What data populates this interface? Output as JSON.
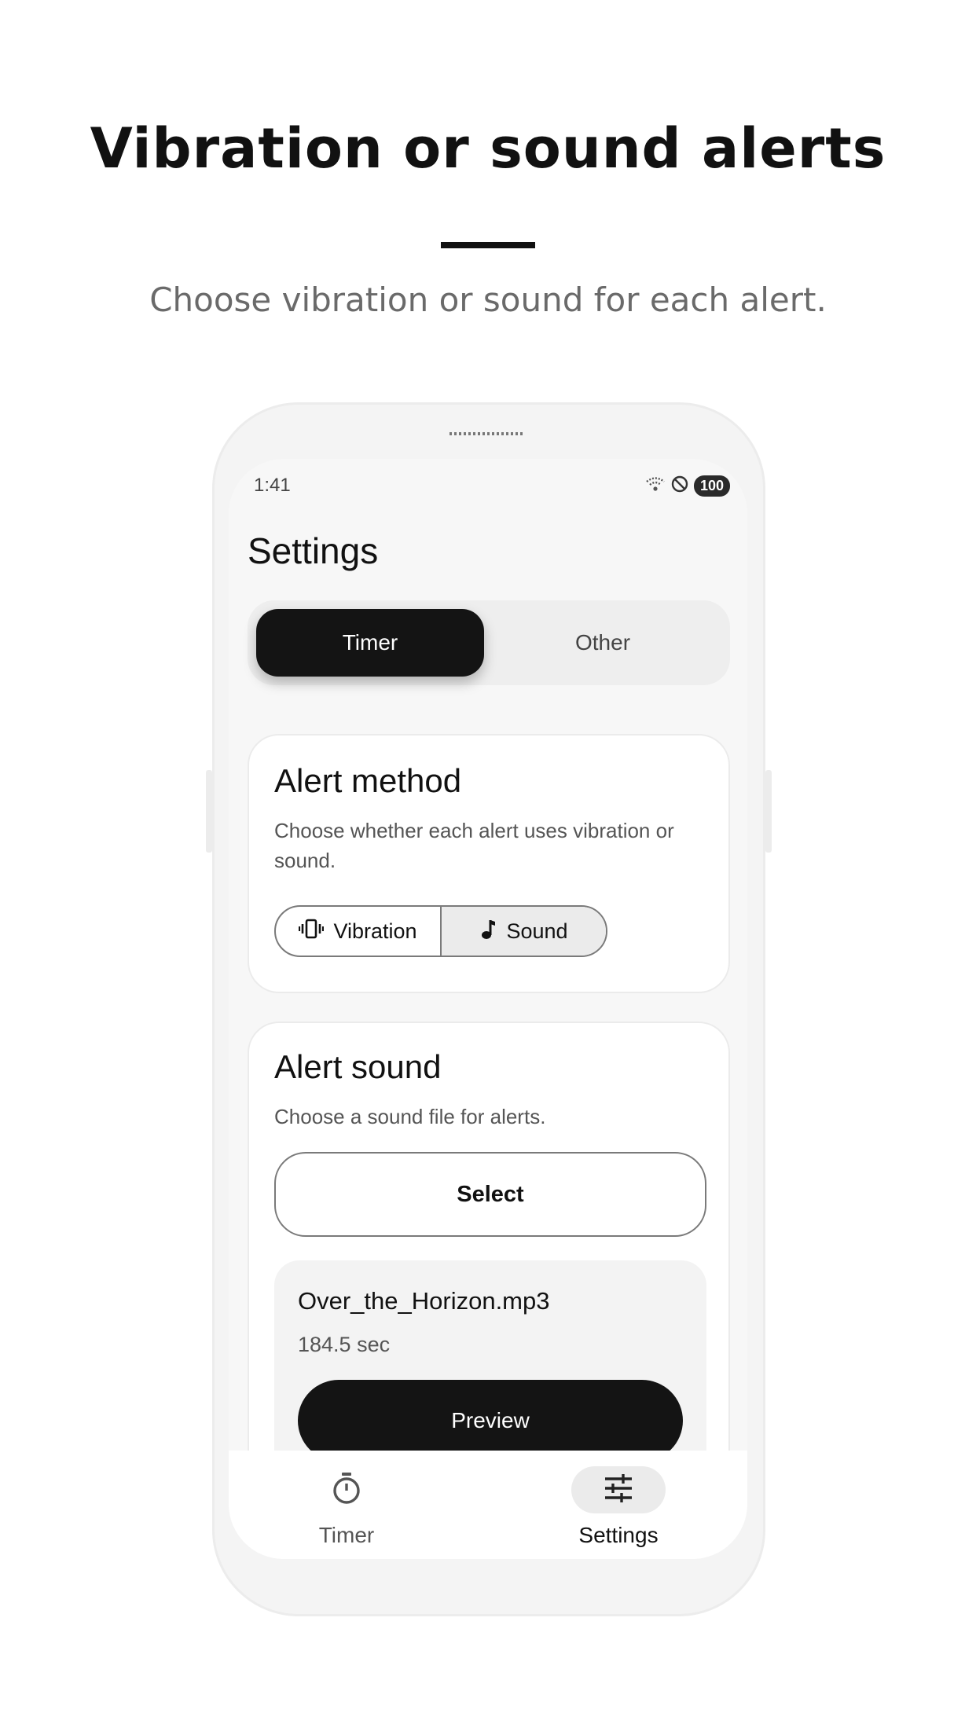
{
  "promo": {
    "headline": "Vibration or sound alerts",
    "subheadline": "Choose vibration or sound for each alert."
  },
  "status_bar": {
    "time": "1:41",
    "battery": "100"
  },
  "screen": {
    "title": "Settings",
    "segments": {
      "active": "Timer",
      "other": "Other"
    }
  },
  "alert_method": {
    "title": "Alert method",
    "description": "Choose whether each alert uses vibration or sound.",
    "options": {
      "vibration": "Vibration",
      "sound": "Sound"
    },
    "selected": "Sound"
  },
  "alert_sound": {
    "title": "Alert sound",
    "description": "Choose a sound file for alerts.",
    "select_label": "Select",
    "file_name": "Over_the_Horizon.mp3",
    "file_length": "184.5 sec",
    "preview_label": "Preview"
  },
  "bottom_nav": {
    "timer_label": "Timer",
    "settings_label": "Settings",
    "active": "Settings"
  },
  "icons": [
    "wifi-icon",
    "do-not-disturb-icon",
    "vibration-icon",
    "music-note-icon",
    "stopwatch-icon",
    "tune-icon"
  ]
}
